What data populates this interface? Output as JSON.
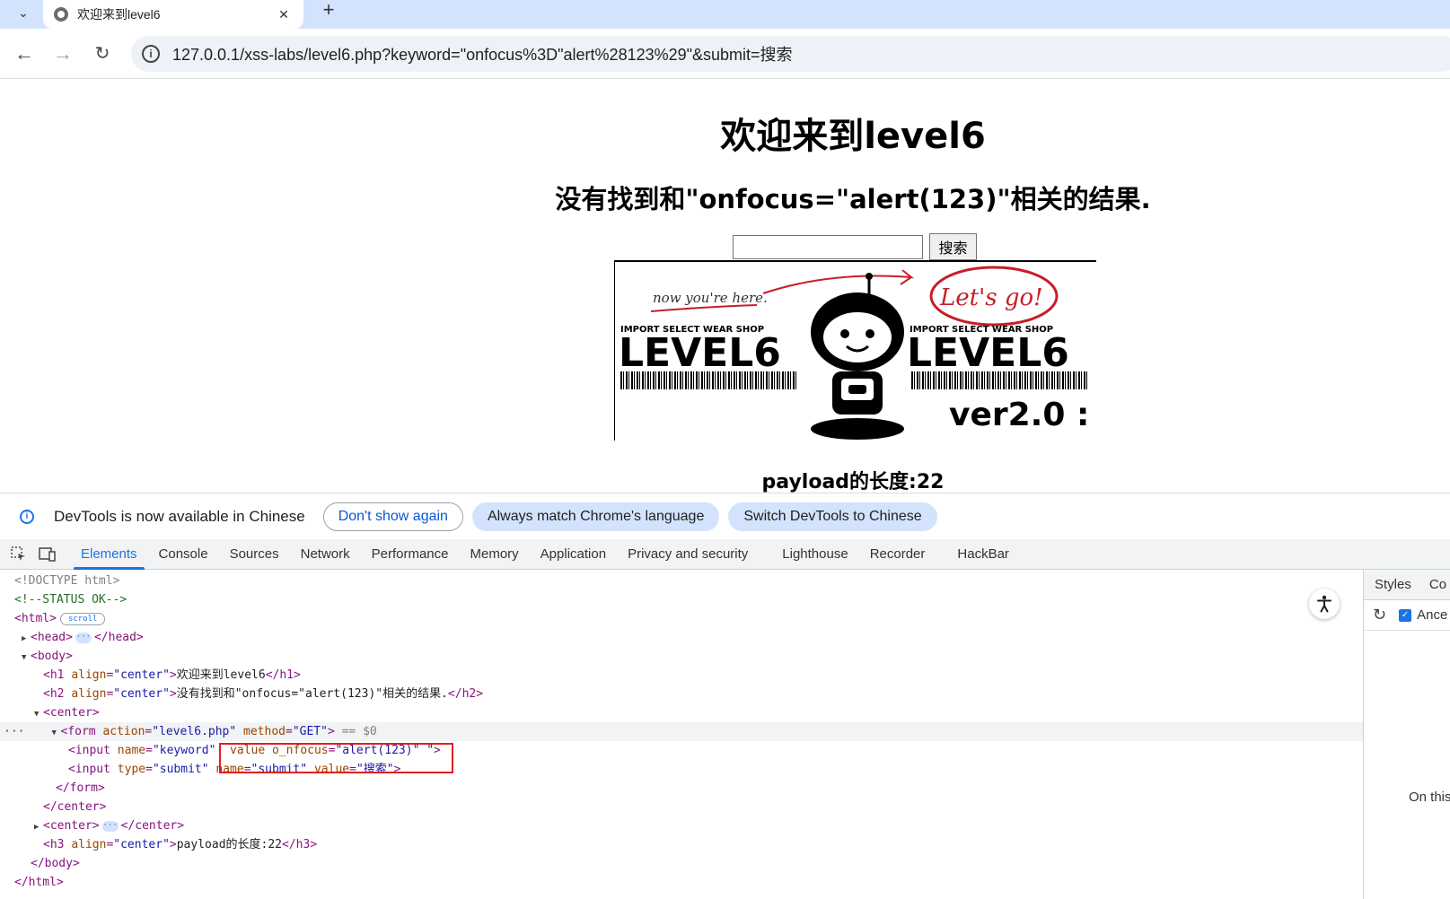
{
  "browser": {
    "tab_title": "欢迎来到level6",
    "url": "127.0.0.1/xss-labs/level6.php?keyword=\"onfocus%3D\"alert%28123%29\"&submit=搜索"
  },
  "page": {
    "h1": "欢迎来到level6",
    "h2": "没有找到和\"onfocus=\"alert(123)\"相关的结果.",
    "submit_label": "搜索",
    "image": {
      "annotation": "now you're here.",
      "bubble": "Let's go!",
      "shop_label": "IMPORT SELECT WEAR SHOP",
      "level_text": "LEVEL6",
      "version": "ver2.0 :"
    },
    "h3": "payload的长度:22"
  },
  "infobar": {
    "message": "DevTools is now available in Chinese",
    "btn_dont_show": "Don't show again",
    "btn_match": "Always match Chrome's language",
    "btn_switch": "Switch DevTools to Chinese"
  },
  "devtools": {
    "tabs": [
      "Elements",
      "Console",
      "Sources",
      "Network",
      "Performance",
      "Memory",
      "Application",
      "Privacy and security",
      "Lighthouse",
      "Recorder",
      "HackBar"
    ],
    "active_tab": "Elements",
    "styles_tab": "Styles",
    "styles_tab2": "Co",
    "ancestors_label": "Ance",
    "on_this": "On this",
    "dom": {
      "doctype": "<!DOCTYPE html>",
      "comment": "<!--STATUS OK-->",
      "scroll_badge": "scroll",
      "h1_text": "欢迎来到level6",
      "h2_text": "没有找到和\"onfocus=\"alert(123)\"相关的结果.",
      "form_action": "level6.php",
      "form_method": "GET",
      "selected_marker": "== $0",
      "input_name": "keyword",
      "input_onfocus_value": "alert(123)",
      "submit_type": "submit",
      "submit_name": "submit",
      "submit_value": "搜索",
      "h3_text": "payload的长度:22"
    }
  }
}
